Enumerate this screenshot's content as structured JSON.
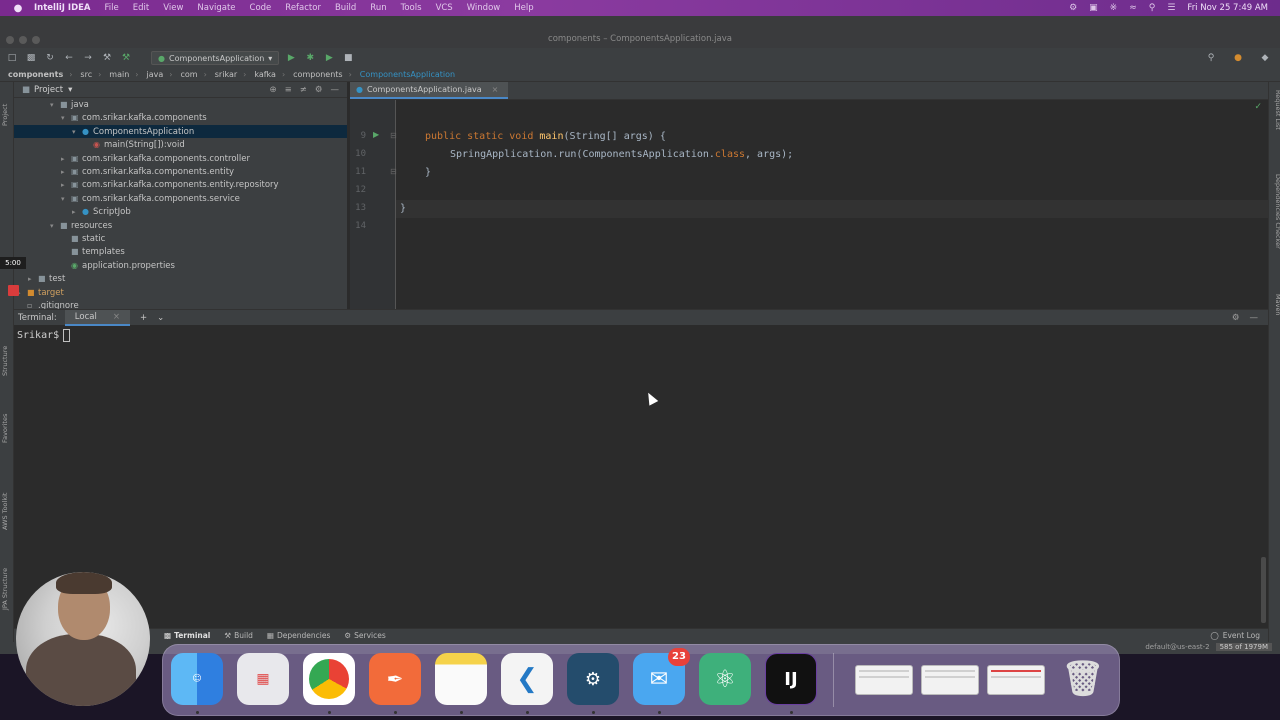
{
  "menubar": {
    "app_name": "IntelliJ IDEA",
    "items": [
      "File",
      "Edit",
      "View",
      "Navigate",
      "Code",
      "Refactor",
      "Build",
      "Run",
      "Tools",
      "VCS",
      "Window",
      "Help"
    ],
    "clock": "Fri Nov 25  7:49 AM"
  },
  "window": {
    "title": "components – ComponentsApplication.java"
  },
  "toolbar": {
    "run_config": "ComponentsApplication"
  },
  "breadcrumb": [
    "components",
    "src",
    "main",
    "java",
    "com",
    "srikar",
    "kafka",
    "components",
    "ComponentsApplication"
  ],
  "project": {
    "header": "Project",
    "tree": [
      {
        "indent": 4,
        "arrow": "v",
        "icon": "folder",
        "label": "java"
      },
      {
        "indent": 5,
        "arrow": "v",
        "icon": "package",
        "label": "com.srikar.kafka.components"
      },
      {
        "indent": 6,
        "arrow": "v",
        "icon": "class",
        "label": "ComponentsApplication",
        "selected": true
      },
      {
        "indent": 7,
        "arrow": "",
        "icon": "method",
        "label": "main(String[]):void"
      },
      {
        "indent": 5,
        "arrow": ">",
        "icon": "package",
        "label": "com.srikar.kafka.components.controller"
      },
      {
        "indent": 5,
        "arrow": ">",
        "icon": "package",
        "label": "com.srikar.kafka.components.entity"
      },
      {
        "indent": 5,
        "arrow": ">",
        "icon": "package",
        "label": "com.srikar.kafka.components.entity.repository"
      },
      {
        "indent": 5,
        "arrow": "v",
        "icon": "package",
        "label": "com.srikar.kafka.components.service"
      },
      {
        "indent": 6,
        "arrow": ">",
        "icon": "class",
        "label": "ScriptJob"
      },
      {
        "indent": 4,
        "arrow": "v",
        "icon": "folder",
        "label": "resources"
      },
      {
        "indent": 5,
        "arrow": "",
        "icon": "folder",
        "label": "static"
      },
      {
        "indent": 5,
        "arrow": "",
        "icon": "folder",
        "label": "templates"
      },
      {
        "indent": 5,
        "arrow": "",
        "icon": "properties",
        "label": "application.properties"
      },
      {
        "indent": 2,
        "arrow": ">",
        "icon": "folder",
        "label": "test"
      },
      {
        "indent": 1,
        "arrow": ">",
        "icon": "folder-orange",
        "label": "target"
      },
      {
        "indent": 1,
        "arrow": "",
        "icon": "file",
        "label": ".gitignore"
      }
    ]
  },
  "editor": {
    "tab": "ComponentsApplication.java",
    "lines": [
      {
        "no": "9",
        "kw": "public static void ",
        "fn": "main",
        "rest": "(String[] args) {",
        "indent": 1
      },
      {
        "no": "10",
        "pre": "SpringApplication.run(ComponentsApplication.",
        "kw2": "class",
        "post": ", args);",
        "indent": 2
      },
      {
        "no": "11",
        "text": "}",
        "indent": 1
      },
      {
        "no": "12",
        "text": "",
        "indent": 0
      },
      {
        "no": "13",
        "text": "}",
        "indent": 0
      },
      {
        "no": "14",
        "text": "",
        "indent": 0
      }
    ]
  },
  "terminal": {
    "label": "Terminal:",
    "tab": "Local",
    "prompt": "Srikar$"
  },
  "left_strip": {
    "project": "Project",
    "structure": "Structure",
    "favorites": "Favorites",
    "aws": "AWS Toolkit",
    "jpa": "JPA Structure",
    "timer": "5:00"
  },
  "right_strip": {
    "request": "Request List",
    "dependencies": "Dependencies Checker",
    "maven": "Maven"
  },
  "bottom_tabs": [
    "Terminal",
    "Build",
    "Dependencies",
    "Services"
  ],
  "event_log": "Event Log",
  "status": {
    "aws": "default@us-east-2",
    "memory": "585 of 1979M"
  },
  "dock": {
    "apps": [
      "Finder",
      "Launchpad",
      "Chrome",
      "Postman",
      "Notes",
      "VS Code",
      "MySQL Workbench",
      "Mail",
      "Atom",
      "IntelliJ IDEA"
    ],
    "mail_badge": "23",
    "intellij_label": "IJ"
  },
  "colors": {
    "menubar": "#7a2a8f",
    "editor_bg": "#2b2b2b",
    "panel_bg": "#3c3f41",
    "keyword": "#cc7832",
    "function": "#ffc66d",
    "selection": "#0d293e"
  }
}
